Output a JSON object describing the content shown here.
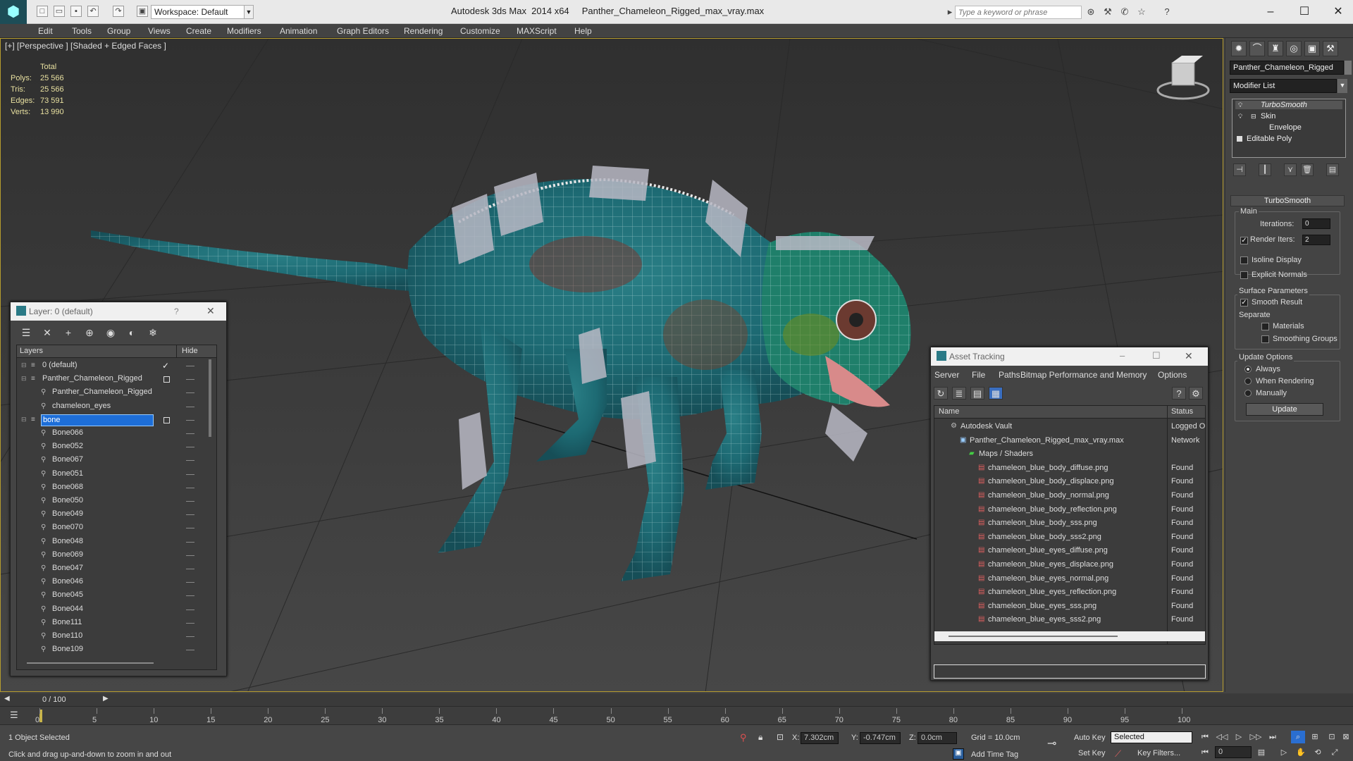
{
  "titlebar": {
    "workspace": "Workspace: Default",
    "title": "Autodesk 3ds Max  2014 x64     Panther_Chameleon_Rigged_max_vray.max",
    "search_placeholder": "Type a keyword or phrase"
  },
  "menu": [
    "Edit",
    "Tools",
    "Group",
    "Views",
    "Create",
    "Modifiers",
    "Animation",
    "Graph Editors",
    "Rendering",
    "Customize",
    "MAXScript",
    "Help"
  ],
  "viewport": {
    "label": "[+] [Perspective ] [Shaded + Edged Faces ]",
    "stats": {
      "header": "Total",
      "rows": [
        {
          "label": "Polys:",
          "value": "25 566"
        },
        {
          "label": "Tris:",
          "value": "25 566"
        },
        {
          "label": "Edges:",
          "value": "73 591"
        },
        {
          "label": "Verts:",
          "value": "13 990"
        }
      ]
    }
  },
  "command_panel": {
    "object_name": "Panther_Chameleon_Rigged",
    "modifier_list": "Modifier List",
    "stack": [
      "TurboSmooth",
      "Skin",
      "Envelope",
      "Editable Poly"
    ],
    "rollout_title": "TurboSmooth",
    "main_label": "Main",
    "iterations_label": "Iterations:",
    "iterations_value": "0",
    "render_iters_label": "Render Iters:",
    "render_iters_value": "2",
    "isoline": "Isoline Display",
    "explicit": "Explicit Normals",
    "surface_params": "Surface Parameters",
    "smooth_result": "Smooth Result",
    "separate": "Separate",
    "materials": "Materials",
    "smoothing_groups": "Smoothing Groups",
    "update_options": "Update Options",
    "always": "Always",
    "when_rendering": "When Rendering",
    "manually": "Manually",
    "update_button": "Update"
  },
  "layer_dialog": {
    "title": "Layer: 0 (default)",
    "help": "?",
    "col_layers": "Layers",
    "col_hide": "Hide",
    "rows": [
      {
        "name": "0 (default)",
        "indent": 1
      },
      {
        "name": "Panther_Chameleon_Rigged",
        "indent": 1
      },
      {
        "name": "Panther_Chameleon_Rigged",
        "indent": 2
      },
      {
        "name": "chameleon_eyes",
        "indent": 2
      },
      {
        "name": "bone",
        "indent": 1
      },
      {
        "name": "Bone066",
        "indent": 2
      },
      {
        "name": "Bone052",
        "indent": 2
      },
      {
        "name": "Bone067",
        "indent": 2
      },
      {
        "name": "Bone051",
        "indent": 2
      },
      {
        "name": "Bone068",
        "indent": 2
      },
      {
        "name": "Bone050",
        "indent": 2
      },
      {
        "name": "Bone049",
        "indent": 2
      },
      {
        "name": "Bone070",
        "indent": 2
      },
      {
        "name": "Bone048",
        "indent": 2
      },
      {
        "name": "Bone069",
        "indent": 2
      },
      {
        "name": "Bone047",
        "indent": 2
      },
      {
        "name": "Bone046",
        "indent": 2
      },
      {
        "name": "Bone045",
        "indent": 2
      },
      {
        "name": "Bone044",
        "indent": 2
      },
      {
        "name": "Bone111",
        "indent": 2
      },
      {
        "name": "Bone110",
        "indent": 2
      },
      {
        "name": "Bone109",
        "indent": 2
      }
    ]
  },
  "asset_dialog": {
    "title": "Asset Tracking",
    "menu": [
      "Server",
      "File",
      "Paths",
      "Bitmap Performance and Memory",
      "Options"
    ],
    "col_name": "Name",
    "col_status": "Status",
    "rows": [
      {
        "name": "Autodesk Vault",
        "status": "Logged O",
        "indent": 1
      },
      {
        "name": "Panther_Chameleon_Rigged_max_vray.max",
        "status": "Network",
        "indent": 2
      },
      {
        "name": "Maps / Shaders",
        "status": "",
        "indent": 3
      },
      {
        "name": "chameleon_blue_body_diffuse.png",
        "status": "Found",
        "indent": 4
      },
      {
        "name": "chameleon_blue_body_displace.png",
        "status": "Found",
        "indent": 4
      },
      {
        "name": "chameleon_blue_body_normal.png",
        "status": "Found",
        "indent": 4
      },
      {
        "name": "chameleon_blue_body_reflection.png",
        "status": "Found",
        "indent": 4
      },
      {
        "name": "chameleon_blue_body_sss.png",
        "status": "Found",
        "indent": 4
      },
      {
        "name": "chameleon_blue_body_sss2.png",
        "status": "Found",
        "indent": 4
      },
      {
        "name": "chameleon_blue_eyes_diffuse.png",
        "status": "Found",
        "indent": 4
      },
      {
        "name": "chameleon_blue_eyes_displace.png",
        "status": "Found",
        "indent": 4
      },
      {
        "name": "chameleon_blue_eyes_normal.png",
        "status": "Found",
        "indent": 4
      },
      {
        "name": "chameleon_blue_eyes_reflection.png",
        "status": "Found",
        "indent": 4
      },
      {
        "name": "chameleon_blue_eyes_sss.png",
        "status": "Found",
        "indent": 4
      },
      {
        "name": "chameleon_blue_eyes_sss2.png",
        "status": "Found",
        "indent": 4
      }
    ]
  },
  "timeline": {
    "frame": "0 / 100",
    "ticks": [
      "0",
      "5",
      "10",
      "15",
      "20",
      "25",
      "30",
      "35",
      "40",
      "45",
      "50",
      "55",
      "60",
      "65",
      "70",
      "75",
      "80",
      "85",
      "90",
      "95",
      "100"
    ]
  },
  "status": {
    "selected": "1 Object Selected",
    "prompt": "Click and drag up-and-down to zoom in and out",
    "x_label": "X:",
    "x_value": "7.302cm",
    "y_label": "Y:",
    "y_value": "-0.747cm",
    "z_label": "Z:",
    "z_value": "0.0cm",
    "grid": "Grid = 10.0cm",
    "add_time_tag": "Add Time Tag",
    "auto_key": "Auto Key",
    "set_key": "Set Key",
    "selected_dropdown": "Selected",
    "key_filters": "Key Filters...",
    "frame_field": "0"
  }
}
